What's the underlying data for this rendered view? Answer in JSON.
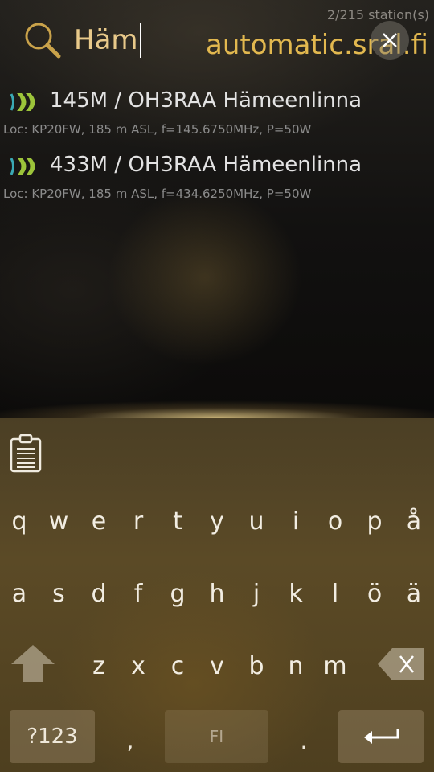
{
  "header": {
    "station_count": "2/215 station(s)",
    "search_value": "Häm",
    "server": "automatic.sral.fi",
    "icons": {
      "search": "search-icon",
      "clear": "close-icon"
    }
  },
  "stations": [
    {
      "title": "145M / OH3RAA Hämeenlinna",
      "details": "Loc: KP20FW, 185 m ASL, f=145.6750MHz, P=50W",
      "icon": "signal-waves-icon"
    },
    {
      "title": "433M / OH3RAA Hämeenlinna",
      "details": "Loc: KP20FW, 185 m ASL, f=434.6250MHz, P=50W",
      "icon": "signal-waves-icon"
    }
  ],
  "keyboard": {
    "row1": [
      "q",
      "w",
      "e",
      "r",
      "t",
      "y",
      "u",
      "i",
      "o",
      "p",
      "å"
    ],
    "row2": [
      "a",
      "s",
      "d",
      "f",
      "g",
      "h",
      "j",
      "k",
      "l",
      "ö",
      "ä"
    ],
    "row3": [
      "z",
      "x",
      "c",
      "v",
      "b",
      "n",
      "m"
    ],
    "symbols_label": "?123",
    "comma": ",",
    "space_label": "FI",
    "period": ".",
    "icons": {
      "clipboard": "clipboard-icon",
      "shift": "shift-icon",
      "backspace": "backspace-icon",
      "enter": "enter-icon"
    }
  },
  "colors": {
    "accent": "#e2b84f",
    "search_text": "#e8c98a",
    "station_icon_green": "#9cc43a",
    "station_icon_teal": "#3aa9b5"
  }
}
